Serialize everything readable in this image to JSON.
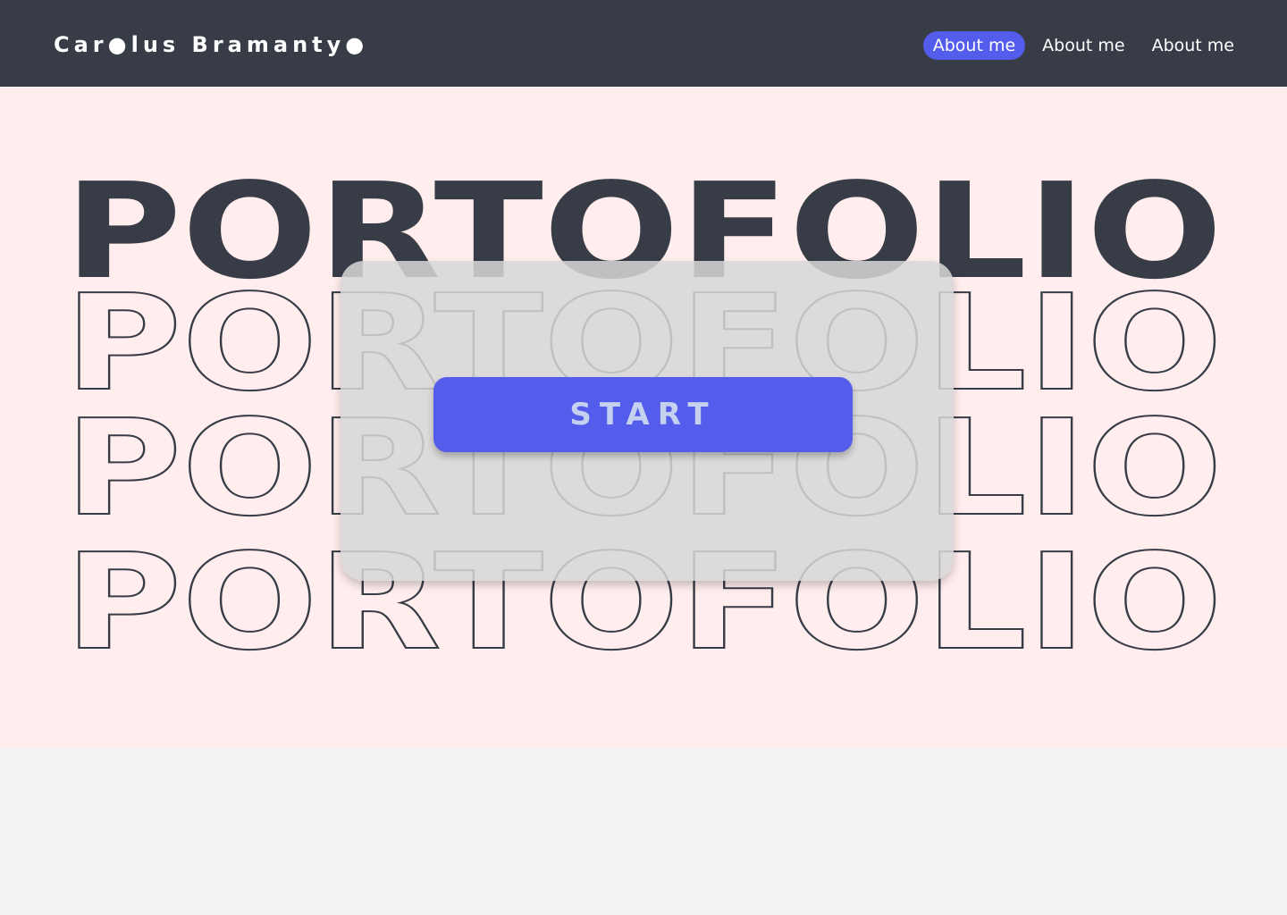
{
  "header": {
    "brand": "Car●lus Bramanty●",
    "nav": [
      {
        "label": "About me",
        "active": true
      },
      {
        "label": "About me",
        "active": false
      },
      {
        "label": "About me",
        "active": false
      }
    ]
  },
  "hero": {
    "title_solid": "PORTOFOLIO",
    "title_outline_rows": [
      "PORTOFOLIO",
      "PORTOFOLIO",
      "PORTOFOLIO"
    ]
  },
  "overlay": {
    "start_label": "START"
  },
  "colors": {
    "navbar": "#383c46",
    "accent": "#535ceb",
    "hero_background": "#ffeeed",
    "page_background": "#f2f2f2",
    "start_text": "#c6d1f0"
  }
}
